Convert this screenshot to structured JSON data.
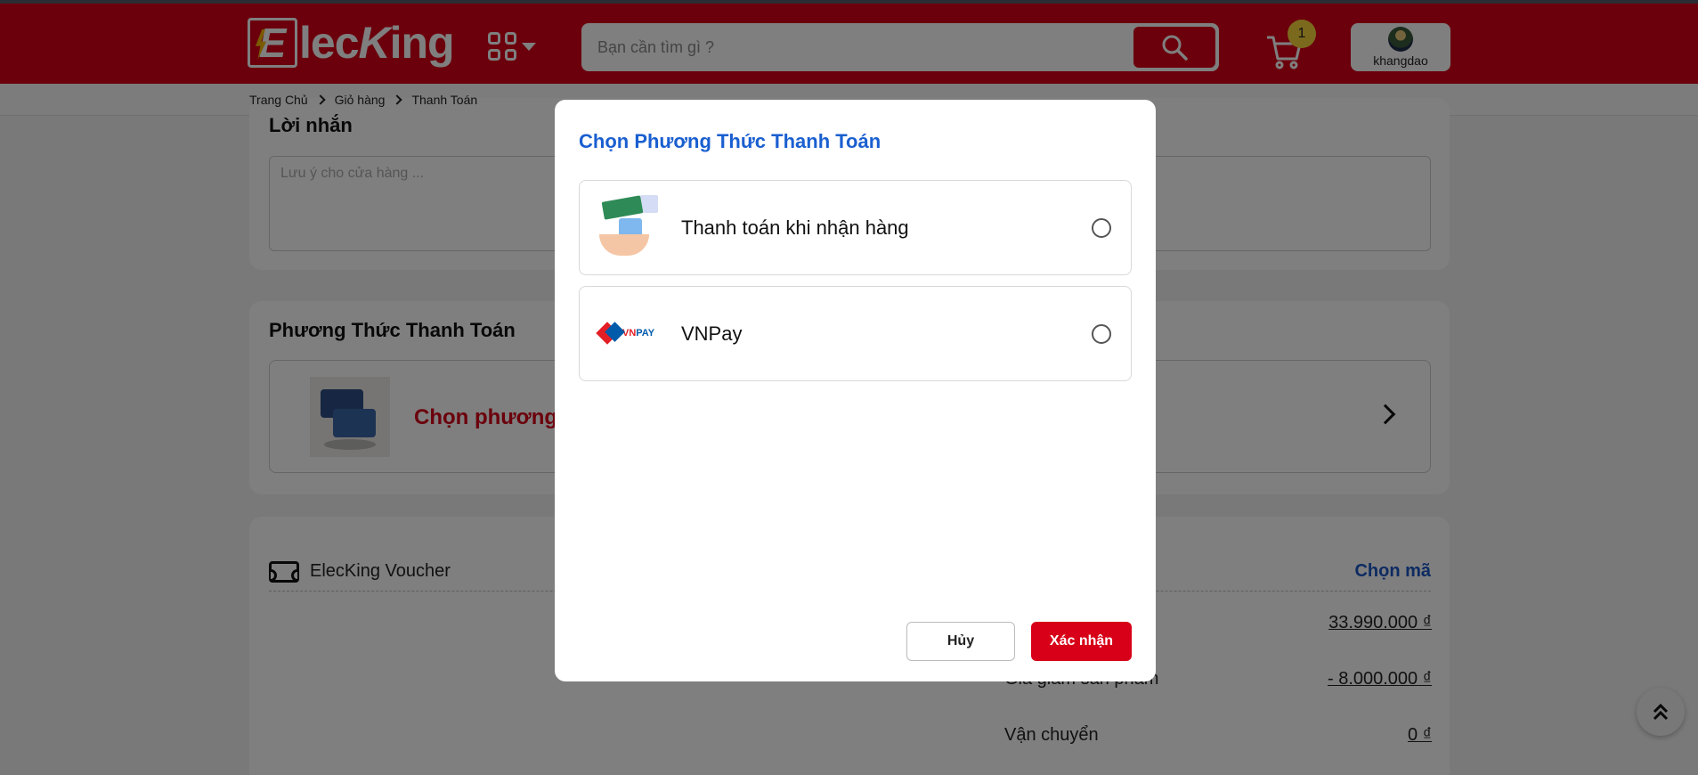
{
  "header": {
    "logo_text": "ElecKing",
    "search_placeholder": "Bạn cần tìm gì ?",
    "cart_count": "1",
    "username": "khangdao"
  },
  "breadcrumb": [
    "Trang Chủ",
    "Giỏ hàng",
    "Thanh Toán"
  ],
  "note_section": {
    "title": "Lời nhắn",
    "placeholder": "Lưu ý cho cửa hàng ..."
  },
  "payment_section": {
    "title": "Phương Thức Thanh Toán",
    "select_label": "Chọn phương t"
  },
  "voucher_section": {
    "label": "ElecKing Voucher",
    "link": "Chọn mã"
  },
  "summary": [
    {
      "label": "",
      "value": "33.990.000 ₫"
    },
    {
      "label": "Giá giảm sản phẩm",
      "value": "- 8.000.000 ₫"
    },
    {
      "label": "Vận chuyển",
      "value": "0 ₫"
    }
  ],
  "modal": {
    "title": "Chọn Phương Thức Thanh Toán",
    "options": [
      {
        "label": "Thanh toán khi nhận hàng",
        "icon": "cash-on-delivery-icon",
        "selected": false
      },
      {
        "label": "VNPay",
        "icon": "vnpay-logo",
        "selected": false
      }
    ],
    "cancel_label": "Hủy",
    "confirm_label": "Xác nhận"
  },
  "colors": {
    "brand_red": "#d70018",
    "title_blue": "#1a5fd0",
    "link_blue": "#1a56c4",
    "badge_yellow": "#f7d43a"
  }
}
